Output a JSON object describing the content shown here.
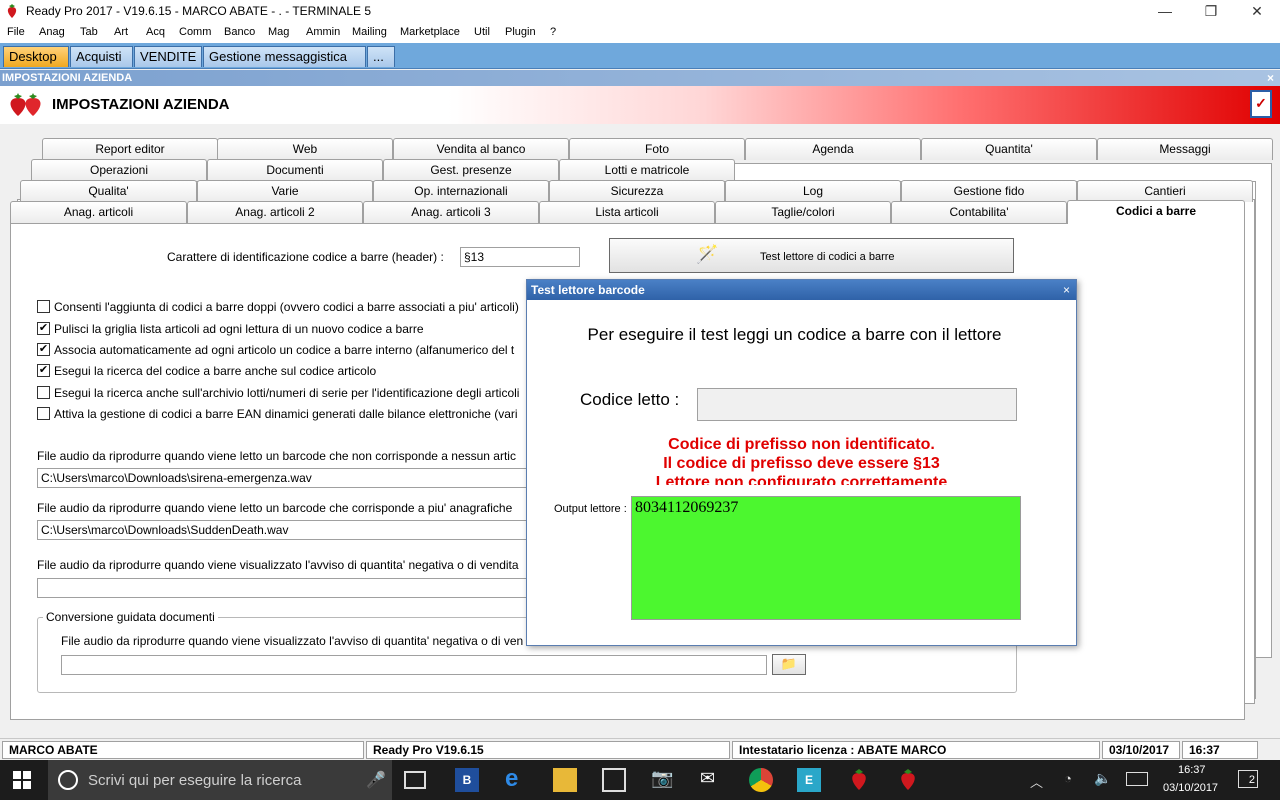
{
  "window": {
    "title": "Ready Pro 2017 - V19.6.15 - MARCO ABATE - . - TERMINALE 5",
    "minimize": "—",
    "maximize": "❐",
    "close": "✕"
  },
  "menu": [
    "File",
    "Anag",
    "Tab",
    "Art",
    "Acq",
    "Comm",
    "Banco",
    "Mag",
    "Ammin",
    "Mailing",
    "Marketplace",
    "Util",
    "Plugin",
    "?"
  ],
  "app_tabs": [
    "Desktop",
    "Acquisti",
    "VENDITE",
    "Gestione messaggistica",
    "..."
  ],
  "caption": {
    "title": "IMPOSTAZIONI AZIENDA",
    "close": "×"
  },
  "header": {
    "title": "IMPOSTAZIONI AZIENDA"
  },
  "tabs": {
    "row1": [
      "Report editor",
      "Web",
      "Vendita al banco",
      "Foto",
      "Agenda",
      "Quantita'",
      "Messaggi"
    ],
    "row2": [
      "Operazioni",
      "Documenti",
      "Gest. presenze",
      "Lotti e matricole"
    ],
    "row3": [
      "Qualita'",
      "Varie",
      "Op. internazionali",
      "Sicurezza",
      "Log",
      "Gestione fido",
      "Cantieri"
    ],
    "row4": [
      "Anag. articoli",
      "Anag. articoli 2",
      "Anag. articoli 3",
      "Lista articoli",
      "Taglie/colori",
      "Contabilita'",
      "Codici a barre"
    ]
  },
  "content": {
    "header_label": "Carattere di identificazione codice a barre (header) :",
    "header_value": "§13",
    "test_button": "Test lettore di codici a barre",
    "checkboxes": [
      {
        "label": "Consenti l'aggiunta di codici a barre doppi (ovvero codici a barre associati a piu' articoli)",
        "checked": false
      },
      {
        "label": "Pulisci la griglia lista articoli ad ogni lettura di un nuovo codice a barre",
        "checked": true
      },
      {
        "label": "Associa automaticamente ad ogni articolo un codice a barre interno (alfanumerico del t",
        "checked": true
      },
      {
        "label": "Esegui la ricerca del codice a barre anche sul codice articolo",
        "checked": true
      },
      {
        "label": "Esegui la ricerca anche sull'archivio lotti/numeri di serie per l'identificazione degli articoli",
        "checked": false
      },
      {
        "label": "Attiva la gestione di codici a barre EAN dinamici generati dalle bilance elettroniche (vari",
        "checked": false
      }
    ],
    "audio1_label": "File audio da riprodurre quando viene letto un barcode che non corrisponde a nessun artic",
    "audio1_value": "C:\\Users\\marco\\Downloads\\sirena-emergenza.wav",
    "audio2_label": "File audio da riprodurre quando viene letto un barcode che corrisponde a piu' anagrafiche",
    "audio2_value": "C:\\Users\\marco\\Downloads\\SuddenDeath.wav",
    "audio3_label": "File audio da riprodurre quando viene visualizzato l'avviso di quantita' negativa o di vendita",
    "audio3_value": "",
    "group_title": "Conversione guidata documenti",
    "audio4_label": "File audio da riprodurre quando viene visualizzato l'avviso di quantita' negativa o di ven",
    "audio4_value": ""
  },
  "dialog": {
    "title": "Test lettore barcode",
    "close": "×",
    "instruction": "Per eseguire il test leggi un codice a barre con il lettore",
    "code_label": "Codice letto :",
    "code_value": "",
    "error_line1": "Codice di prefisso non identificato.",
    "error_line2": "Il codice di prefisso deve essere §13",
    "error_line3": "Lettore non configurato correttamente",
    "output_label": "Output lettore :",
    "output_value": "8034112069237",
    "error_color": "#e00000",
    "output_bg": "#4cf72f"
  },
  "status": {
    "user": "MARCO ABATE",
    "version": "Ready Pro V19.6.15",
    "license": "Intestatario licenza : ABATE MARCO",
    "date": "03/10/2017",
    "time": "16:37"
  },
  "taskbar": {
    "search_placeholder": "Scrivi qui per eseguire la ricerca",
    "clock_time": "16:37",
    "clock_date": "03/10/2017",
    "notifications": "2"
  },
  "colors": {
    "accent": "#2f62a8",
    "active_tab": "#f0a820"
  }
}
